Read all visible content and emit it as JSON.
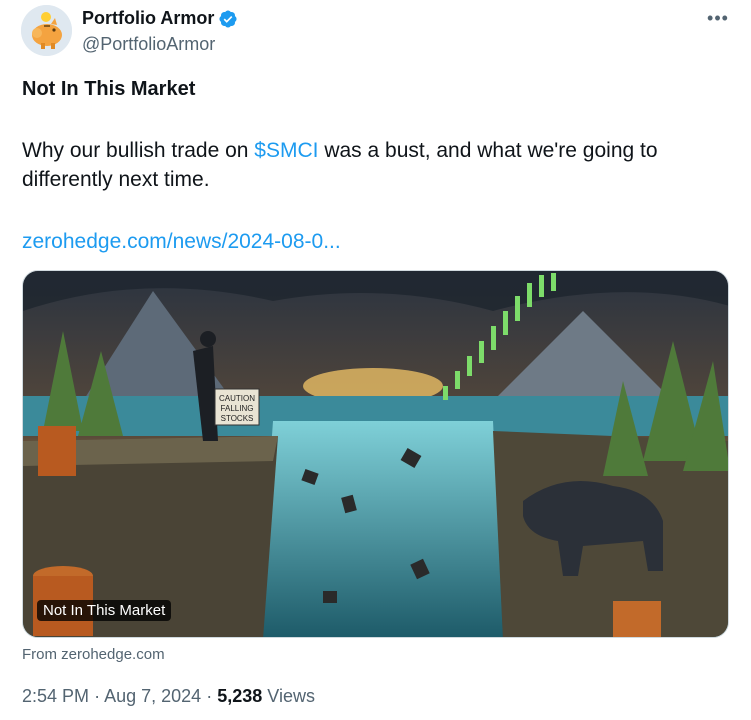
{
  "author": {
    "name": "Portfolio Armor",
    "handle": "@PortfolioArmor",
    "verified": true,
    "avatar_icon": "piggy-bank-avatar"
  },
  "menu": {
    "more_label": "•••"
  },
  "tweet": {
    "title": "Not In This Market",
    "text_before": "Why our bullish trade on ",
    "cashtag": "$SMCI",
    "text_after": " was a bust, and what we're going to differently next time.",
    "link": "zerohedge.com/news/2024-08-0..."
  },
  "card": {
    "label": "Not In This Market",
    "source": "From zerohedge.com",
    "sign_text_1": "CAUTION",
    "sign_text_2": "FALLING",
    "sign_text_3": "STOCKS"
  },
  "meta": {
    "time": "2:54 PM",
    "separator": "·",
    "date": "Aug 7, 2024",
    "views_count": "5,238",
    "views_label": "Views"
  },
  "colors": {
    "accent": "#1d9bf0",
    "text_primary": "#0f1419",
    "text_secondary": "#536471"
  }
}
